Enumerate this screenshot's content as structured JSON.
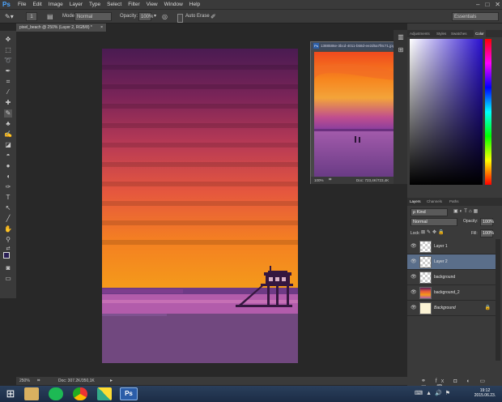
{
  "app": {
    "logo": "Ps"
  },
  "menu": [
    "File",
    "Edit",
    "Image",
    "Layer",
    "Type",
    "Select",
    "Filter",
    "View",
    "Window",
    "Help"
  ],
  "window_controls": [
    "–",
    "□",
    "✕"
  ],
  "options_bar": {
    "brush_size": "1",
    "mode_label": "Mode:",
    "mode_value": "Normal",
    "opacity_label": "Opacity:",
    "opacity_value": "100%",
    "auto_erase_label": "Auto Erase",
    "workspace": "Essentials"
  },
  "document_tab": {
    "title": "pixel_beach @ 250% (Layer 2, RGB/8) *",
    "close": "×"
  },
  "status": {
    "zoom": "250%",
    "doc": "Doc: 307.2K/350,1K"
  },
  "float_window": {
    "title": "1388586e-3bcd-4011-b58d-ee2d5a7f8c71.jpg @ 100% (...",
    "zoom": "100%",
    "doc": "Doc: 723,4K/723,4K"
  },
  "color_tabs": [
    "Adjustments",
    "Styles",
    "Swatches",
    "Color"
  ],
  "layers_tabs": [
    "Layers",
    "Channels",
    "Paths"
  ],
  "layers_panel": {
    "kind": "ρ Kind",
    "blend": "Normal",
    "opacity_label": "Opacity:",
    "opacity_value": "100%",
    "lock_label": "Lock:",
    "fill_label": "Fill:",
    "fill_value": "100%",
    "layers": [
      {
        "name": "Layer 1",
        "selected": false
      },
      {
        "name": "Layer 2",
        "selected": true
      },
      {
        "name": "background",
        "selected": false
      },
      {
        "name": "background_2",
        "selected": false
      },
      {
        "name": "Background",
        "selected": false
      }
    ]
  },
  "taskbar": {
    "time": "19:12",
    "date": "2015.06.23."
  },
  "colors": {
    "accent": "#4da6ff",
    "selected_layer": "#5a6e8a"
  }
}
